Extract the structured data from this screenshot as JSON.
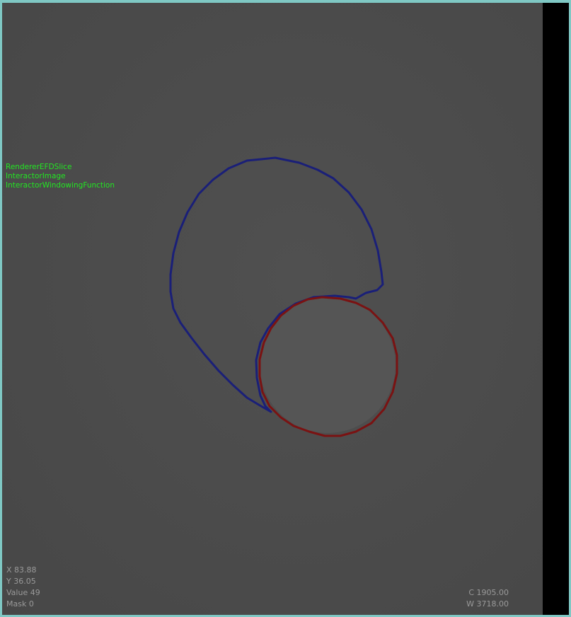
{
  "interactors": [
    "RendererEFDSlice",
    "InteractorImage",
    "InteractorWindowingFunction"
  ],
  "cursor": {
    "x_label": "X",
    "x_value": "83.88",
    "y_label": "Y",
    "y_value": "36.05",
    "value_label": "Value",
    "value_value": "49",
    "mask_label": "Mask",
    "mask_value": "0"
  },
  "windowing": {
    "c_label": "C",
    "c_value": "1905.00",
    "w_label": "W",
    "w_value": "3718.00"
  },
  "colors": {
    "frame": "#7fc8c4",
    "background": "#4a4a4a",
    "outer_contour": "#1a1f78",
    "inner_contour": "#7a1212",
    "object_fill": "#555555",
    "interactor_text": "#22e622",
    "info_text": "#9a9a9a"
  }
}
